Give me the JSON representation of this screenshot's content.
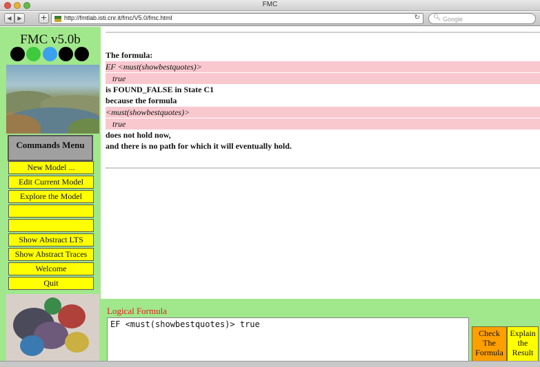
{
  "window": {
    "title": "FMC"
  },
  "browser": {
    "address": "http://fmtlab.isti.cnr.it/fmc/V5.0/fmc.html",
    "search_placeholder": "Google",
    "back_icon": "back-arrow-icon",
    "forward_icon": "forward-arrow-icon",
    "add_icon": "plus-icon",
    "reload_icon": "reload-icon"
  },
  "sidebar": {
    "app_title": "FMC v5.0b",
    "status_dots": [
      {
        "color": "#000000"
      },
      {
        "color": "#3ec93e"
      },
      {
        "color": "#3aa0f0"
      },
      {
        "color": "#000000"
      },
      {
        "color": "#000000"
      }
    ],
    "commands_menu_title": "Commands Menu",
    "menu_items": [
      {
        "label": "New Model ..."
      },
      {
        "label": "Edit Current Model"
      },
      {
        "label": "Explore the Model"
      },
      {
        "label": ""
      },
      {
        "label": ""
      },
      {
        "label": "Show Abstract LTS"
      },
      {
        "label": "Show Abstract Traces"
      },
      {
        "label": "Welcome"
      },
      {
        "label": "Quit"
      }
    ]
  },
  "result": {
    "lines": [
      {
        "text": "The formula:",
        "style": "bold"
      },
      {
        "text": "EF <must(showbestquotes)>",
        "style": "pink"
      },
      {
        "text": "true",
        "style": "pink-indent"
      },
      {
        "text": " is FOUND_FALSE in State C1",
        "style": "bold"
      },
      {
        "text": "because the formula",
        "style": "bold"
      },
      {
        "text": "<must(showbestquotes)>",
        "style": "pink"
      },
      {
        "text": "true",
        "style": "pink-indent"
      },
      {
        "text": "does not hold now,",
        "style": "bold"
      },
      {
        "text": "and there is no path for which it will eventually hold.",
        "style": "bold"
      }
    ]
  },
  "formula_panel": {
    "label": "Logical Formula",
    "value": "EF <must(showbestquotes)> true",
    "check_button": "Check\nThe\nFormula",
    "explain_button": "Explain\nthe\nResult"
  },
  "colors": {
    "panel_green": "#a0e88b",
    "menu_yellow": "#ffff00",
    "highlight_pink": "#f8c8ce",
    "check_orange": "#ff9f00",
    "label_red": "#e02020"
  }
}
